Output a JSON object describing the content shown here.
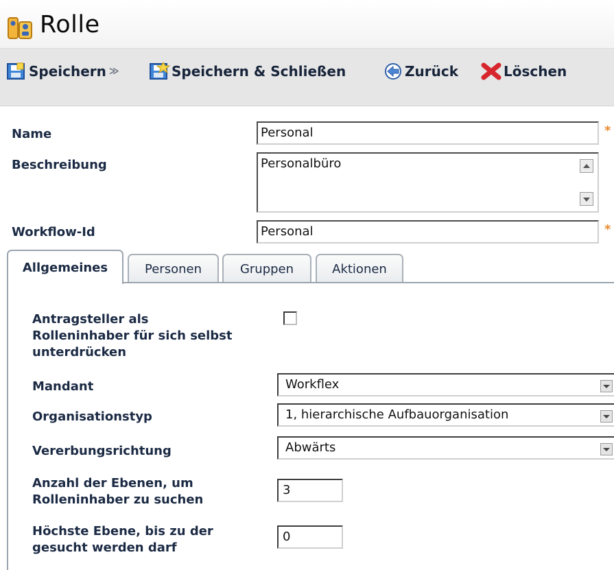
{
  "window": {
    "title": "Rolle",
    "icon": "role-icon"
  },
  "toolbar": {
    "save_label": "Speichern",
    "save_dropdown_glyph": "≫",
    "save_close_label": "Speichern & Schließen",
    "back_label": "Zurück",
    "delete_label": "Löschen",
    "icons": [
      "save-icon",
      "save-close-icon",
      "back-icon",
      "delete-icon"
    ]
  },
  "form": {
    "name": {
      "label": "Name",
      "value": "Personal",
      "required_mark": "*"
    },
    "description": {
      "label": "Beschreibung",
      "value": "Personalbüro"
    },
    "workflow_id": {
      "label": "Workflow-Id",
      "value": "Personal",
      "required_mark": "*"
    }
  },
  "tabs": [
    {
      "label": "Allgemeines",
      "active": true
    },
    {
      "label": "Personen",
      "active": false
    },
    {
      "label": "Gruppen",
      "active": false
    },
    {
      "label": "Aktionen",
      "active": false
    }
  ],
  "general": {
    "suppress_applicant": {
      "label_line1": "Antragsteller als",
      "label_line2": "Rolleninhaber für sich selbst",
      "label_line3": "unterdrücken",
      "checked": false
    },
    "client": {
      "label": "Mandant",
      "value": "Workflex"
    },
    "org_type": {
      "label": "Organisationstyp",
      "value": "1, hierarchische Aufbauorganisation"
    },
    "inheritance": {
      "label": "Vererbungsrichtung",
      "value": "Abwärts"
    },
    "levels": {
      "label_line1": "Anzahl der Ebenen, um",
      "label_line2": "Rolleninhaber zu suchen",
      "value": "3"
    },
    "max_level": {
      "label_line1": "Höchste Ebene, bis zu der",
      "label_line2": "gesucht werden darf",
      "value": "0"
    }
  },
  "colors": {
    "required": "#e8892c",
    "text": "#1b2a44",
    "toolbar_bg": "#e6e6e6"
  }
}
